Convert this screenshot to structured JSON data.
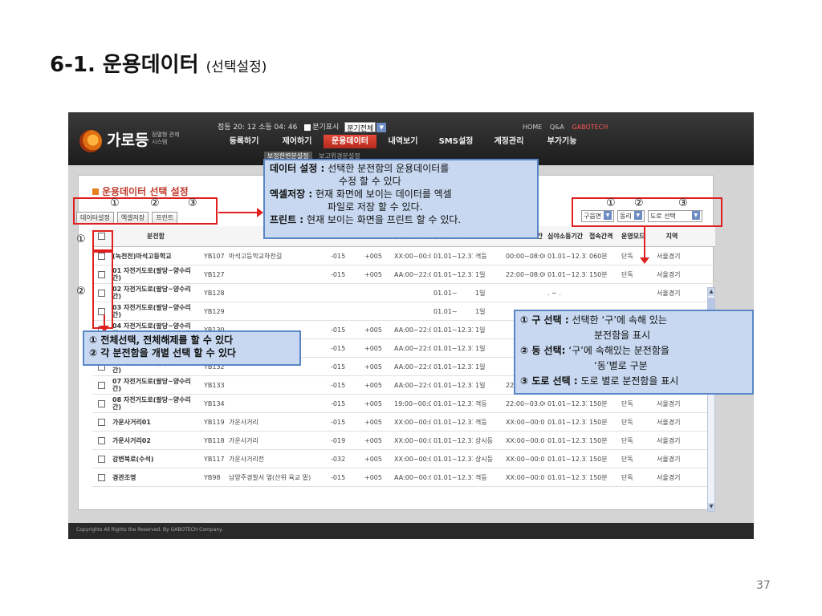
{
  "slide": {
    "title": "6-1. 운용데이터",
    "subtitle": "(선택설정)",
    "page_number": "37"
  },
  "app": {
    "logo_text": "가로등",
    "logo_subtitle": "점멸형 관제시스템",
    "status": {
      "time": "점등 20: 12 소등 04: 46",
      "option_label": "분기표시",
      "select_value": "분기전체"
    },
    "toplinks": [
      "HOME",
      "Q&A",
      "GABOTECH"
    ],
    "nav": [
      "등록하기",
      "제어하기",
      "운용데이터",
      "내역보기",
      "SMS설정",
      "계정관리",
      "부가기능"
    ],
    "subnav": [
      "보정한변분설정",
      "보고위경분설정"
    ],
    "panel_title": "운용데이터 선택 설정",
    "buttons": [
      "데이터설정",
      "엑셀저장",
      "프린트"
    ],
    "filters": [
      "구읍면",
      "동리",
      "도로 선택"
    ],
    "columns": [
      "",
      "분전함",
      "",
      "",
      "",
      "",
      "(제작시간)",
      "(제작기간)",
      "",
      "시간",
      "심야소등기간",
      "접속간격",
      "운영모드",
      "지역"
    ],
    "rows": [
      [
        "(녹천천)마석고등학교",
        "YB107",
        "마석고등학교하천길",
        "-015",
        "+005",
        "XX:00~00:00",
        "01.01~12.31",
        "격등",
        "00:00~08:00",
        "01.01~12.31",
        "060분",
        "단독",
        "서울경기"
      ],
      [
        "01 자전거도로(팔당~양수리간)",
        "YB127",
        "",
        "-015",
        "+005",
        "AA:00~22:00",
        "01.01~12.31",
        "1일",
        "22:00~08:00",
        "01.01~12.31",
        "150분",
        "단독",
        "서울경기"
      ],
      [
        "02 자전거도로(팔당~양수리간)",
        "YB128",
        "",
        "",
        "",
        "",
        "01.01~",
        "1일",
        "",
        ". ~ .",
        "",
        "",
        "서울경기"
      ],
      [
        "03 자전거도로(팔당~양수리간)",
        "YB129",
        "",
        "",
        "",
        "",
        "01.01~",
        "1일",
        "",
        "",
        "",
        "",
        ""
      ],
      [
        "04 자전거도로(팔당~양수리간)",
        "YB130",
        "",
        "-015",
        "+005",
        "AA:00~22:00",
        "01.01~12.31",
        "1일",
        "",
        "",
        "",
        "",
        ""
      ],
      [
        "05 자전거도로(팔당~양수리간)",
        "YB131",
        "",
        "-015",
        "+005",
        "AA:00~22:00",
        "01.01~12.31",
        "1일",
        "",
        "",
        "",
        "",
        ""
      ],
      [
        "06 자전거도로(팔당~양수리간)",
        "YB132",
        "",
        "-015",
        "+005",
        "AA:00~22:00",
        "01.01~12.31",
        "1일",
        "",
        "",
        "",
        "",
        ""
      ],
      [
        "07 자전거도로(팔당~양수리간)",
        "YB133",
        "",
        "-015",
        "+005",
        "AA:00~22:00",
        "01.01~12.31",
        "1일",
        "22:00~03:00",
        "01.01~12.31",
        "150분",
        "단독",
        "서울경기"
      ],
      [
        "08 자전거도로(팔당~양수리간)",
        "YB134",
        "",
        "-015",
        "+005",
        "19:00~00:00",
        "01.01~12.31",
        "격등",
        "22:00~03:00",
        "01.01~12.31",
        "150분",
        "단독",
        "서울경기"
      ],
      [
        "가운사거리01",
        "YB119",
        "가운사거리",
        "-015",
        "+005",
        "XX:00~00:00",
        "01.01~12.31",
        "격등",
        "XX:00~00:00",
        "01.01~12.31",
        "150분",
        "단독",
        "서울경기"
      ],
      [
        "가운사거리02",
        "YB118",
        "가운사거리",
        "-019",
        "+005",
        "XX:00~00:00",
        "01.01~12.31",
        "상시등",
        "XX:00~00:00",
        "01.01~12.31",
        "150분",
        "단독",
        "서울경기"
      ],
      [
        "강변북로(수석)",
        "YB117",
        "가운사거리전",
        "-032",
        "+005",
        "XX:00~00:00",
        "01.01~12.31",
        "상시등",
        "XX:00~00:00",
        "01.01~12.31",
        "150분",
        "단독",
        "서울경기"
      ],
      [
        "경관조명",
        "YB98",
        "남양주경찰서 옆(산위 육교 밑)",
        "-015",
        "+005",
        "AA:00~00:00",
        "01.01~12.31",
        "격등",
        "XX:00~00:00",
        "01.01~12.31",
        "150분",
        "단독",
        "서울경기"
      ]
    ],
    "footer": "Copyrights All Rights the Reserved. By GABOTECH Company."
  },
  "annotations": {
    "markers": {
      "btn_1": "①",
      "btn_2": "②",
      "btn_3": "③",
      "flt_1": "①",
      "flt_2": "②",
      "flt_3": "③",
      "left_1": "①",
      "left_2": "②"
    },
    "top_box": {
      "l1_key": "데이터 설정 :",
      "l1_val": "선택한 분전함의 운용데이터를",
      "l2": "수정 할 수 있다",
      "l3_key": "엑셀저장 :",
      "l3_val": "현재 화면에 보이는 데이터를 엑셀",
      "l4": "파일로 저장 할 수 있다.",
      "l5_key": "프린트 :",
      "l5_val": "현재 보이는 화면을 프린트 할 수 있다."
    },
    "left_box": {
      "l1": "① 전체선택, 전체해제를 할 수 있다",
      "l2": "② 각 분전함을 개별 선택 할 수 있다"
    },
    "right_box": {
      "l1_key": "① 구 선택 :",
      "l1_val": "선택한 ‘구’에 속해 있는",
      "l2": "분전함을 표시",
      "l3_key": "② 동 선택:",
      "l3_val": "‘구’에 속해있는 분전함을",
      "l4": "‘동’별로 구분",
      "l5_key": "③ 도로 선택 :",
      "l5_val": "도로 별로 분전함을 표시"
    }
  },
  "colors": {
    "annotation_border": "#e02020",
    "callout_fill": "#c7d8f0",
    "callout_border": "#5b86c6",
    "active_nav": "#d03a2c"
  }
}
